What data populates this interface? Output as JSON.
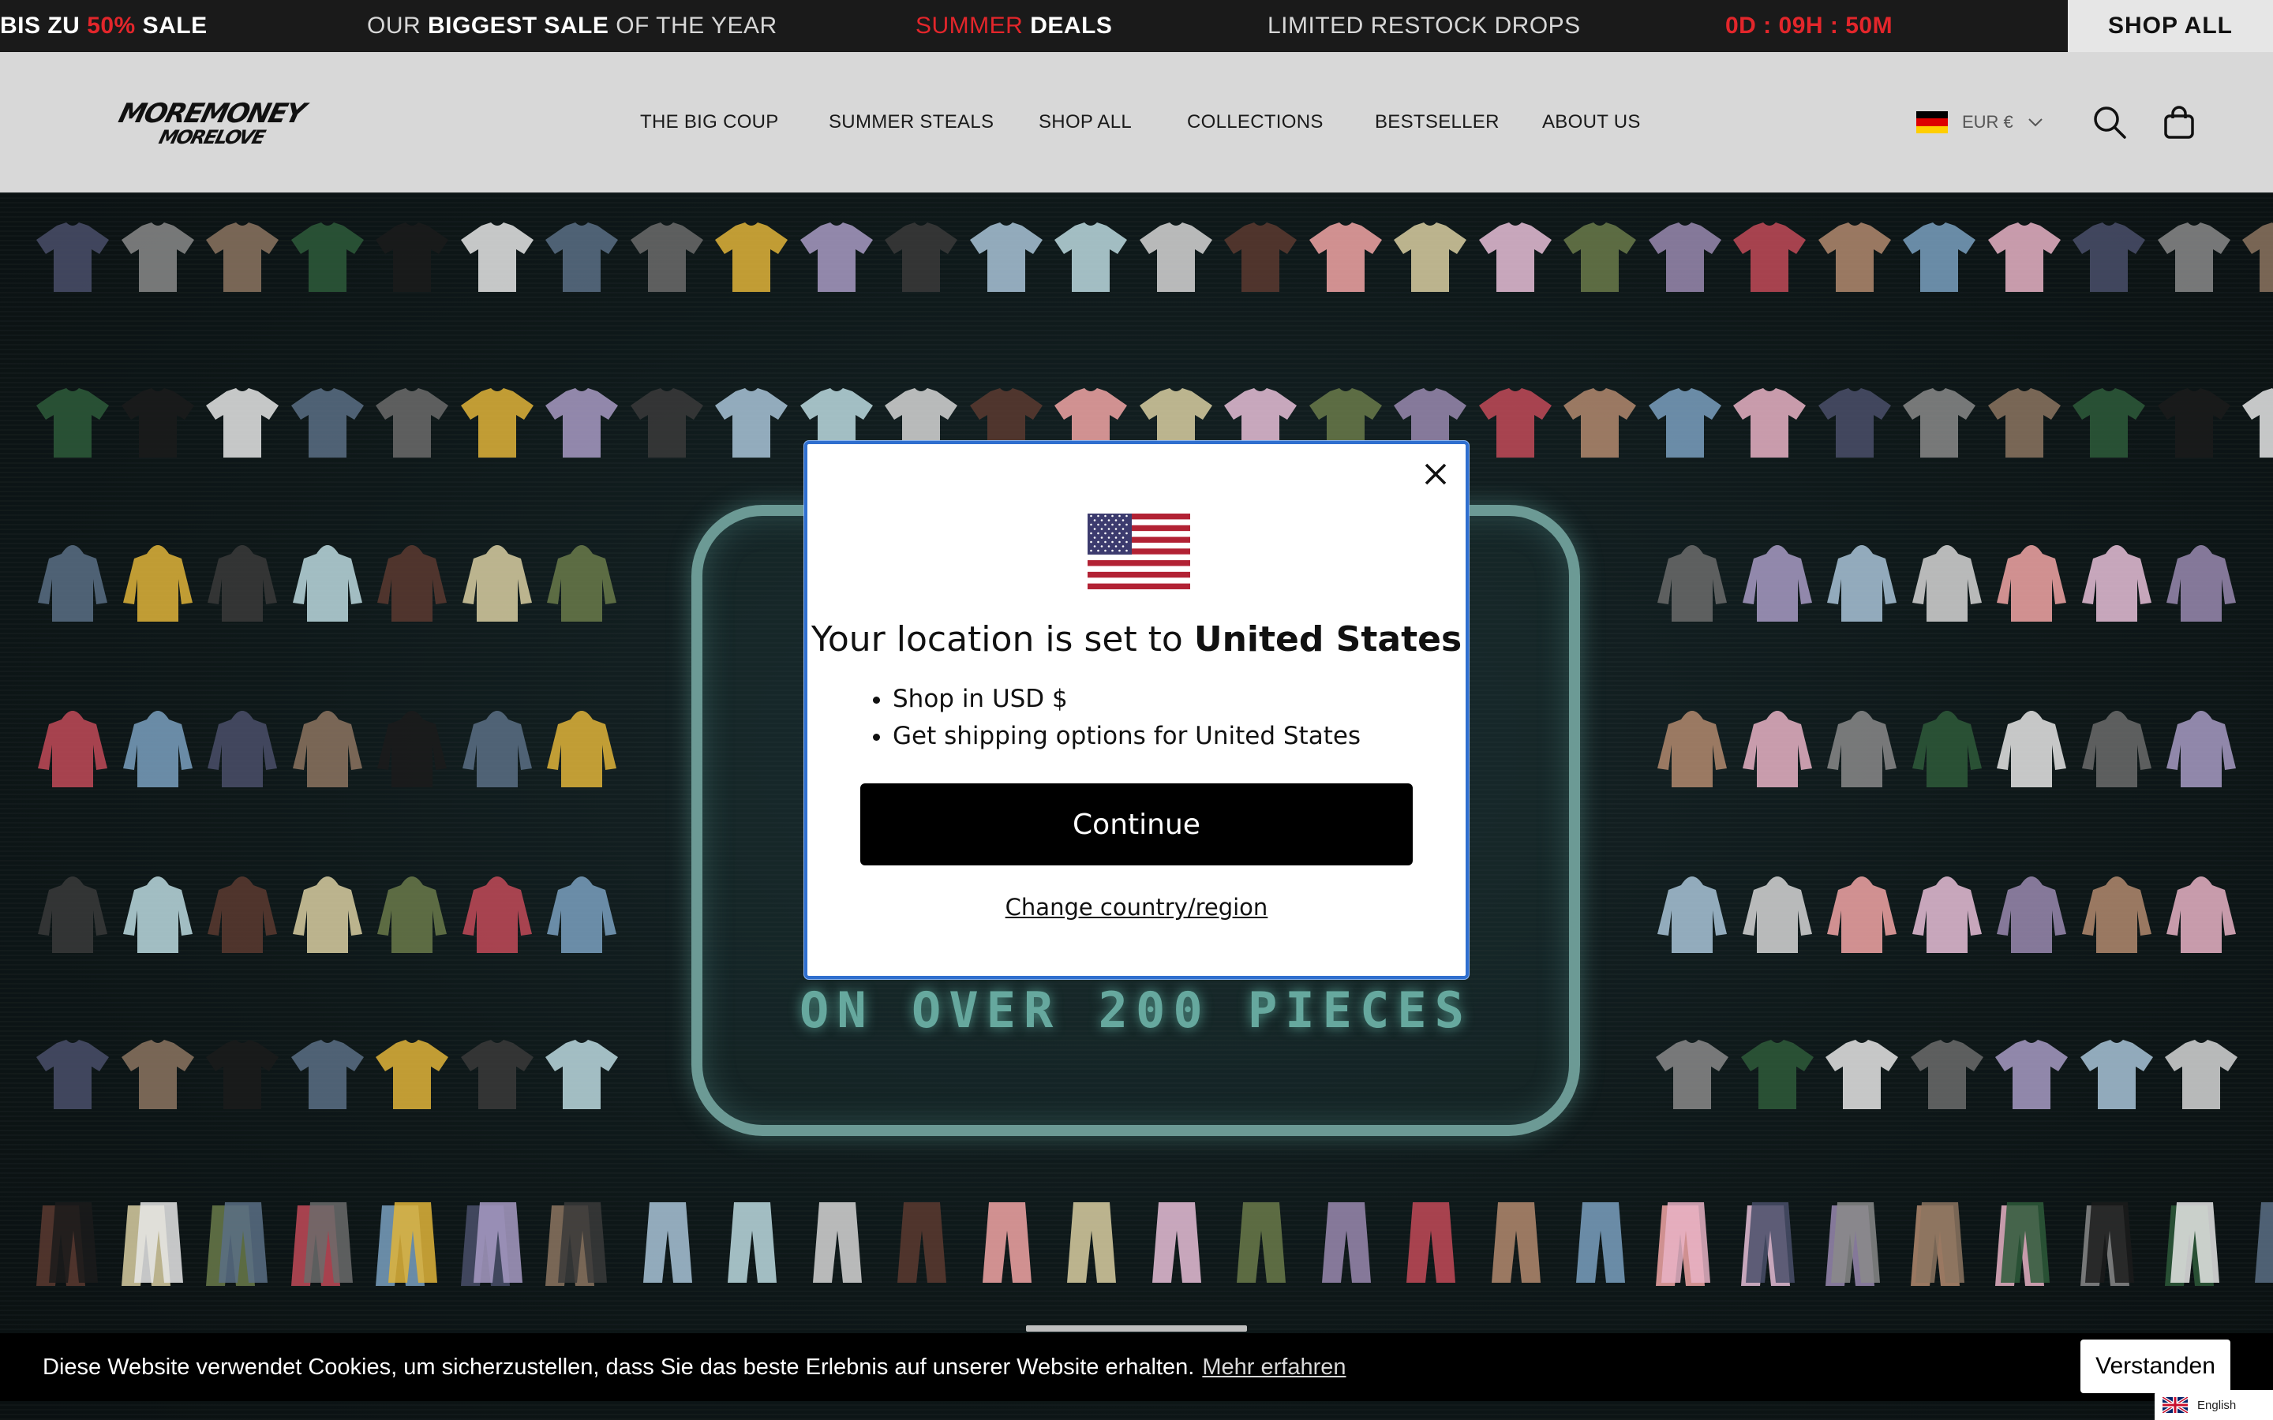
{
  "announcement": {
    "sale_prefix": "BIS ZU",
    "sale_percent": "50%",
    "sale_suffix": "SALE",
    "biggest_prefix": "OUR",
    "biggest_bold": "BIGGEST SALE",
    "biggest_suffix": "OF THE YEAR",
    "summer_red": "SUMMER",
    "summer_bold": "DEALS",
    "restock": "LIMITED RESTOCK DROPS",
    "countdown": "0D : 09H : 50M",
    "shop_all": "SHOP ALL"
  },
  "header": {
    "logo_line1": "MOREMONEY",
    "logo_line2": "MORELOVE",
    "nav": [
      "THE BIG COUP",
      "SUMMER STEALS",
      "SHOP ALL",
      "COLLECTIONS",
      "BESTSELLER",
      "ABOUT US"
    ],
    "currency": "EUR €",
    "icons": {
      "flag": "germany-flag-icon",
      "dropdown": "chevron-down-icon",
      "search": "search-icon",
      "cart": "shopping-bag-icon"
    }
  },
  "hero": {
    "banner_text": "ON OVER 200 PIECES"
  },
  "modal": {
    "title_prefix": "Your location is set to",
    "title_country": "United States",
    "bullets": [
      "Shop in USD $",
      "Get shipping options for United States"
    ],
    "continue_label": "Continue",
    "change_label": "Change country/region",
    "icons": {
      "flag": "us-flag-icon",
      "close": "close-icon"
    }
  },
  "cookie": {
    "message": "Diese Website verwendet Cookies, um sicherzustellen, dass Sie das beste Erlebnis auf unserer Website erhalten.",
    "more_label": "Mehr erfahren",
    "accept_label": "Verstanden"
  },
  "language": {
    "label": "English",
    "icon": "uk-flag-icon"
  },
  "colors": {
    "accent_red": "#e3262b",
    "announcement_bg": "#1a1a1a",
    "header_bg": "#d8d8d8",
    "modal_border": "#2f6fcf",
    "button_bg": "#000000"
  }
}
